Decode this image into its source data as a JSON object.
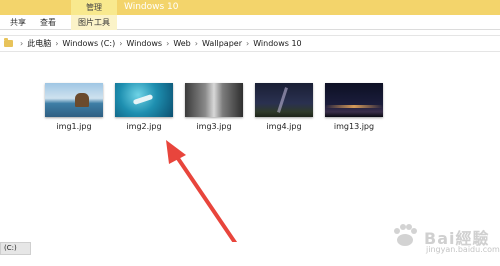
{
  "titlebar": {
    "manage_label": "管理",
    "window_title": "Windows 10"
  },
  "ribbon": {
    "tabs": [
      "共享",
      "查看",
      "图片工具"
    ]
  },
  "address": {
    "crumbs": [
      "此电脑",
      "Windows (C:)",
      "Windows",
      "Web",
      "Wallpaper",
      "Windows 10"
    ]
  },
  "files": [
    {
      "name": "img1.jpg",
      "icon": "image-thumbnail"
    },
    {
      "name": "img2.jpg",
      "icon": "image-thumbnail"
    },
    {
      "name": "img3.jpg",
      "icon": "image-thumbnail"
    },
    {
      "name": "img4.jpg",
      "icon": "image-thumbnail"
    },
    {
      "name": "img13.jpg",
      "icon": "image-thumbnail"
    }
  ],
  "statusbar": {
    "drive_label": "(C:)"
  },
  "watermark": {
    "text": "Bai經驗",
    "url": "jingyan.baidu.com"
  },
  "colors": {
    "title_bar": "#f3d46b",
    "manage_tab": "#f8e98e",
    "arrow": "#e8453c"
  }
}
